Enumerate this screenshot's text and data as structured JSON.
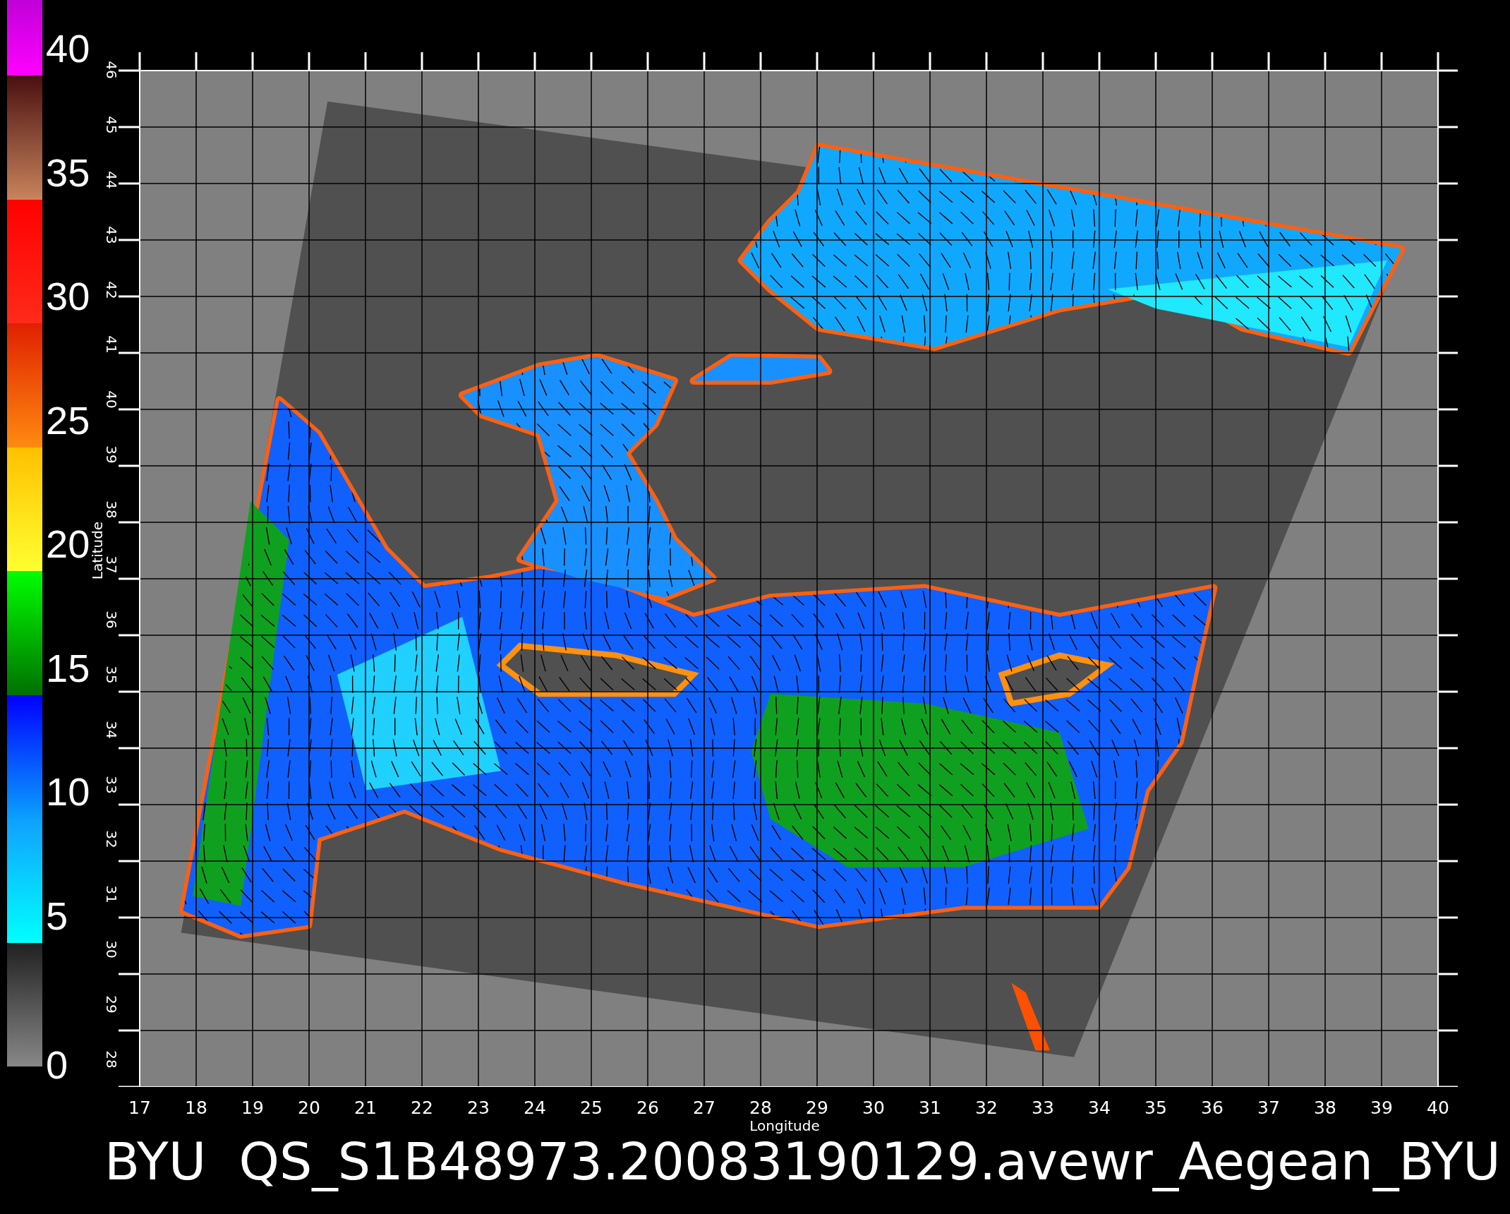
{
  "colorbar": {
    "labels": [
      "40",
      "35",
      "30",
      "25",
      "20",
      "15",
      "10",
      "5",
      "0"
    ]
  },
  "plot": {
    "y_axis": {
      "title": "Latitude",
      "ticks": [
        "46",
        "45",
        "44",
        "43",
        "42",
        "41",
        "40",
        "39",
        "38",
        "37",
        "36",
        "35",
        "34",
        "33",
        "32",
        "31",
        "30",
        "29",
        "28"
      ]
    },
    "x_axis": {
      "title": "Longitude",
      "ticks": [
        "17",
        "18",
        "19",
        "20",
        "21",
        "22",
        "23",
        "24",
        "25",
        "26",
        "27",
        "28",
        "29",
        "30",
        "31",
        "32",
        "33",
        "34",
        "35",
        "36",
        "37",
        "38",
        "39",
        "40"
      ]
    }
  },
  "title": "BYU  QS_S1B48973.20083190129.avewr_Aegean_BYU"
}
